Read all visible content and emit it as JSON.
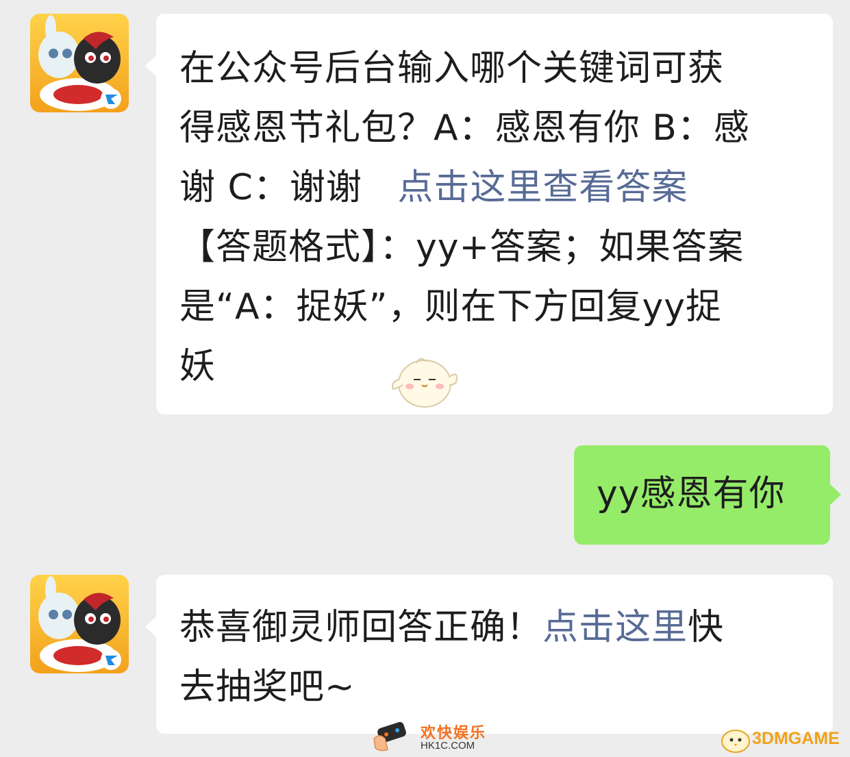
{
  "messages": [
    {
      "sender": "official-account",
      "lines": [
        "在公众号后台输入哪个关键词可获",
        "得感恩节礼包？A：感恩有你 B：感",
        "谢 C：谢谢",
        "【答题格式】：yy+答案；如果答案",
        "是“A：捉妖”，则在下方回复yy捉",
        "妖"
      ],
      "link_text": "点击这里查看答案",
      "emoji": "chick-emoji"
    },
    {
      "sender": "me",
      "text": "yy感恩有你"
    },
    {
      "sender": "official-account",
      "line1_prefix": "恭喜御灵师回答正确！",
      "link_text": "点击这里",
      "line1_suffix": "快",
      "line2": "去抽奖吧~"
    }
  ],
  "watermarks": {
    "left_name": "欢快娱乐",
    "left_url": "HK1C.COM",
    "right_name": "3DMGAME"
  },
  "colors": {
    "background": "#ededed",
    "incoming_bubble": "#ffffff",
    "outgoing_bubble": "#95ec69",
    "link": "#576b95",
    "text": "#1d1d1d"
  }
}
